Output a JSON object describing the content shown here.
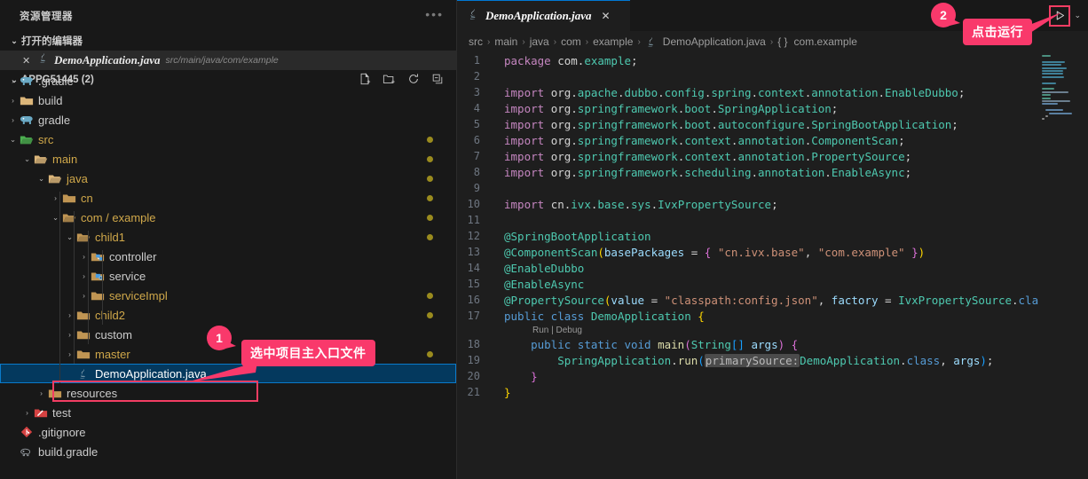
{
  "sidebar": {
    "title": "资源管理器",
    "more_icon": "ellipsis-icon",
    "open_editors": {
      "header": "打开的编辑器",
      "caret": "⌄",
      "item": {
        "close": "✕",
        "icon": "java-icon",
        "name": "DemoApplication.java",
        "path": "src/main/java/com/example"
      }
    },
    "project": {
      "header": "APPG51445 (2)",
      "caret": "⌄",
      "actions": [
        "new-file-icon",
        "new-folder-icon",
        "refresh-icon",
        "collapse-all-icon"
      ]
    },
    "tree": [
      {
        "label": ".gradle",
        "indent": 1,
        "caret": "›",
        "icon": "gradle-folder-icon",
        "color": "gradle",
        "dot": false,
        "selected": false
      },
      {
        "label": "build",
        "indent": 1,
        "caret": "›",
        "icon": "folder-icon",
        "color": "yellow",
        "dot": false,
        "selected": false
      },
      {
        "label": "gradle",
        "indent": 1,
        "caret": "›",
        "icon": "gradle-folder-icon",
        "color": "gradle",
        "dot": false,
        "selected": false
      },
      {
        "label": "src",
        "indent": 1,
        "caret": "⌄",
        "icon": "src-folder-icon",
        "color": "green",
        "dot": true,
        "selected": false,
        "active": true
      },
      {
        "label": "main",
        "indent": 2,
        "caret": "⌄",
        "icon": "folder-icon",
        "color": "yellow",
        "dot": true,
        "selected": false
      },
      {
        "label": "java",
        "indent": 3,
        "caret": "⌄",
        "icon": "folder-icon",
        "color": "yellow",
        "dot": true,
        "selected": false
      },
      {
        "label": "cn",
        "indent": 4,
        "caret": "›",
        "icon": "folder-icon",
        "color": "tan",
        "dot": true,
        "selected": false
      },
      {
        "label": "com / example",
        "indent": 4,
        "caret": "⌄",
        "icon": "folder-icon",
        "color": "tan",
        "dot": true,
        "selected": false,
        "active": true
      },
      {
        "label": "child1",
        "indent": 5,
        "caret": "⌄",
        "icon": "folder-icon",
        "color": "tan",
        "dot": true,
        "selected": false,
        "active": true
      },
      {
        "label": "controller",
        "indent": 6,
        "caret": "›",
        "icon": "controller-folder-icon",
        "color": "blue",
        "dot": false,
        "selected": false
      },
      {
        "label": "service",
        "indent": 6,
        "caret": "›",
        "icon": "service-folder-icon",
        "color": "blue",
        "dot": false,
        "selected": false
      },
      {
        "label": "serviceImpl",
        "indent": 6,
        "caret": "›",
        "icon": "folder-icon",
        "color": "tan",
        "dot": true,
        "selected": false,
        "active": true
      },
      {
        "label": "child2",
        "indent": 5,
        "caret": "›",
        "icon": "folder-icon",
        "color": "tan",
        "dot": true,
        "selected": false,
        "active": true
      },
      {
        "label": "custom",
        "indent": 5,
        "caret": "›",
        "icon": "folder-icon",
        "color": "tan",
        "dot": false,
        "selected": false
      },
      {
        "label": "master",
        "indent": 5,
        "caret": "›",
        "icon": "folder-icon",
        "color": "tan",
        "dot": true,
        "selected": false,
        "active": true
      },
      {
        "label": "DemoApplication.java",
        "indent": 5,
        "caret": "",
        "icon": "java-icon",
        "color": "none",
        "dot": false,
        "selected": true
      },
      {
        "label": "resources",
        "indent": 3,
        "caret": "›",
        "icon": "folder-icon",
        "color": "tan",
        "dot": false,
        "selected": false
      },
      {
        "label": "test",
        "indent": 2,
        "caret": "›",
        "icon": "test-folder-icon",
        "color": "red",
        "dot": false,
        "selected": false
      },
      {
        "label": ".gitignore",
        "indent": 1,
        "caret": "",
        "icon": "git-icon",
        "color": "red",
        "dot": false,
        "selected": false
      },
      {
        "label": "build.gradle",
        "indent": 1,
        "caret": "",
        "icon": "gradle-file-icon",
        "color": "none",
        "dot": false,
        "selected": false
      }
    ]
  },
  "editor": {
    "tab": {
      "icon": "java-icon",
      "name": "DemoApplication.java",
      "close": "✕"
    },
    "run_button": {
      "icon": "play-triangle-icon",
      "chevron": "⌄"
    },
    "breadcrumb": [
      "src",
      "main",
      "java",
      "com",
      "example",
      "DemoApplication.java",
      "com.example"
    ],
    "breadcrumb_sep": "›",
    "breadcrumb_icons": {
      "file": "java-icon",
      "symbol": "{ }"
    },
    "codelens": "Run | Debug",
    "lines": [
      {
        "n": "1",
        "tokens": [
          [
            "t-ctl",
            "package "
          ],
          [
            "t-plain",
            "com."
          ],
          [
            "t-pkg",
            "example"
          ],
          [
            "t-plain",
            ";"
          ]
        ]
      },
      {
        "n": "2",
        "tokens": []
      },
      {
        "n": "3",
        "tokens": [
          [
            "t-ctl",
            "import "
          ],
          [
            "t-plain",
            "org."
          ],
          [
            "t-pkg",
            "apache"
          ],
          [
            "t-plain",
            "."
          ],
          [
            "t-pkg",
            "dubbo"
          ],
          [
            "t-plain",
            "."
          ],
          [
            "t-pkg",
            "config"
          ],
          [
            "t-plain",
            "."
          ],
          [
            "t-pkg",
            "spring"
          ],
          [
            "t-plain",
            "."
          ],
          [
            "t-pkg",
            "context"
          ],
          [
            "t-plain",
            "."
          ],
          [
            "t-pkg",
            "annotation"
          ],
          [
            "t-plain",
            "."
          ],
          [
            "t-cls",
            "EnableDubbo"
          ],
          [
            "t-plain",
            ";"
          ]
        ]
      },
      {
        "n": "4",
        "tokens": [
          [
            "t-ctl",
            "import "
          ],
          [
            "t-plain",
            "org."
          ],
          [
            "t-pkg",
            "springframework"
          ],
          [
            "t-plain",
            "."
          ],
          [
            "t-pkg",
            "boot"
          ],
          [
            "t-plain",
            "."
          ],
          [
            "t-cls",
            "SpringApplication"
          ],
          [
            "t-plain",
            ";"
          ]
        ]
      },
      {
        "n": "5",
        "tokens": [
          [
            "t-ctl",
            "import "
          ],
          [
            "t-plain",
            "org."
          ],
          [
            "t-pkg",
            "springframework"
          ],
          [
            "t-plain",
            "."
          ],
          [
            "t-pkg",
            "boot"
          ],
          [
            "t-plain",
            "."
          ],
          [
            "t-pkg",
            "autoconfigure"
          ],
          [
            "t-plain",
            "."
          ],
          [
            "t-cls",
            "SpringBootApplication"
          ],
          [
            "t-plain",
            ";"
          ]
        ]
      },
      {
        "n": "6",
        "tokens": [
          [
            "t-ctl",
            "import "
          ],
          [
            "t-plain",
            "org."
          ],
          [
            "t-pkg",
            "springframework"
          ],
          [
            "t-plain",
            "."
          ],
          [
            "t-pkg",
            "context"
          ],
          [
            "t-plain",
            "."
          ],
          [
            "t-pkg",
            "annotation"
          ],
          [
            "t-plain",
            "."
          ],
          [
            "t-cls",
            "ComponentScan"
          ],
          [
            "t-plain",
            ";"
          ]
        ]
      },
      {
        "n": "7",
        "tokens": [
          [
            "t-ctl",
            "import "
          ],
          [
            "t-plain",
            "org."
          ],
          [
            "t-pkg",
            "springframework"
          ],
          [
            "t-plain",
            "."
          ],
          [
            "t-pkg",
            "context"
          ],
          [
            "t-plain",
            "."
          ],
          [
            "t-pkg",
            "annotation"
          ],
          [
            "t-plain",
            "."
          ],
          [
            "t-cls",
            "PropertySource"
          ],
          [
            "t-plain",
            ";"
          ]
        ]
      },
      {
        "n": "8",
        "tokens": [
          [
            "t-ctl",
            "import "
          ],
          [
            "t-plain",
            "org."
          ],
          [
            "t-pkg",
            "springframework"
          ],
          [
            "t-plain",
            "."
          ],
          [
            "t-pkg",
            "scheduling"
          ],
          [
            "t-plain",
            "."
          ],
          [
            "t-pkg",
            "annotation"
          ],
          [
            "t-plain",
            "."
          ],
          [
            "t-cls",
            "EnableAsync"
          ],
          [
            "t-plain",
            ";"
          ]
        ]
      },
      {
        "n": "9",
        "tokens": []
      },
      {
        "n": "10",
        "tokens": [
          [
            "t-ctl",
            "import "
          ],
          [
            "t-plain",
            "cn."
          ],
          [
            "t-pkg",
            "ivx"
          ],
          [
            "t-plain",
            "."
          ],
          [
            "t-pkg",
            "base"
          ],
          [
            "t-plain",
            "."
          ],
          [
            "t-pkg",
            "sys"
          ],
          [
            "t-plain",
            "."
          ],
          [
            "t-cls",
            "IvxPropertySource"
          ],
          [
            "t-plain",
            ";"
          ]
        ]
      },
      {
        "n": "11",
        "tokens": []
      },
      {
        "n": "12",
        "tokens": [
          [
            "t-ann",
            "@SpringBootApplication"
          ]
        ]
      },
      {
        "n": "13",
        "tokens": [
          [
            "t-ann",
            "@ComponentScan"
          ],
          [
            "t-br",
            "("
          ],
          [
            "t-var",
            "basePackages"
          ],
          [
            "t-plain",
            " = "
          ],
          [
            "t-br2",
            "{ "
          ],
          [
            "t-str",
            "\"cn.ivx.base\""
          ],
          [
            "t-plain",
            ", "
          ],
          [
            "t-str",
            "\"com.example\""
          ],
          [
            "t-br2",
            " }"
          ],
          [
            "t-br",
            ")"
          ]
        ]
      },
      {
        "n": "14",
        "tokens": [
          [
            "t-ann",
            "@EnableDubbo"
          ]
        ]
      },
      {
        "n": "15",
        "tokens": [
          [
            "t-ann",
            "@EnableAsync"
          ]
        ]
      },
      {
        "n": "16",
        "tokens": [
          [
            "t-ann",
            "@PropertySource"
          ],
          [
            "t-br",
            "("
          ],
          [
            "t-var",
            "value"
          ],
          [
            "t-plain",
            " = "
          ],
          [
            "t-str",
            "\"classpath:config.json\""
          ],
          [
            "t-plain",
            ", "
          ],
          [
            "t-var",
            "factory"
          ],
          [
            "t-plain",
            " = "
          ],
          [
            "t-cls",
            "IvxPropertySource"
          ],
          [
            "t-plain",
            "."
          ],
          [
            "t-kw",
            "class"
          ],
          [
            "t-br",
            ")"
          ]
        ]
      },
      {
        "n": "17",
        "tokens": [
          [
            "t-kw",
            "public class "
          ],
          [
            "t-cls",
            "DemoApplication"
          ],
          [
            "t-plain",
            " "
          ],
          [
            "t-br",
            "{"
          ]
        ]
      },
      {
        "n": "18",
        "tokens": [
          [
            "t-plain",
            "    "
          ],
          [
            "t-kw",
            "public static void "
          ],
          [
            "t-fn",
            "main"
          ],
          [
            "t-br2",
            "("
          ],
          [
            "t-cls",
            "String"
          ],
          [
            "t-br3",
            "[]"
          ],
          [
            "t-plain",
            " "
          ],
          [
            "t-var",
            "args"
          ],
          [
            "t-br2",
            ")"
          ],
          [
            "t-plain",
            " "
          ],
          [
            "t-br2",
            "{"
          ]
        ],
        "indent": 1
      },
      {
        "n": "19",
        "tokens": [
          [
            "t-plain",
            "        "
          ],
          [
            "t-cls",
            "SpringApplication"
          ],
          [
            "t-plain",
            "."
          ],
          [
            "t-fn",
            "run"
          ],
          [
            "t-br3",
            "("
          ],
          [
            "inlay",
            "primarySource:"
          ],
          [
            "t-cls",
            "DemoApplication"
          ],
          [
            "t-plain",
            "."
          ],
          [
            "t-kw",
            "class"
          ],
          [
            "t-plain",
            ", "
          ],
          [
            "t-var",
            "args"
          ],
          [
            "t-br3",
            ")"
          ],
          [
            "t-plain",
            ";"
          ]
        ],
        "indent": 2
      },
      {
        "n": "20",
        "tokens": [
          [
            "t-plain",
            "    "
          ],
          [
            "t-br2",
            "}"
          ]
        ],
        "indent": 1
      },
      {
        "n": "21",
        "tokens": [
          [
            "t-br",
            "}"
          ]
        ]
      }
    ]
  },
  "annotations": [
    {
      "badge": "1",
      "text": "选中项目主入口文件",
      "color": "#f9396b"
    },
    {
      "badge": "2",
      "text": "点击运行",
      "color": "#f9396b"
    }
  ]
}
